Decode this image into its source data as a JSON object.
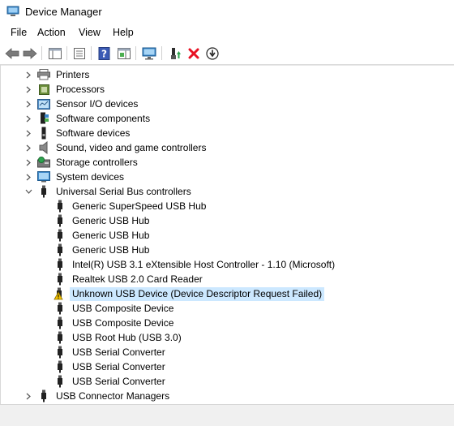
{
  "window": {
    "title": "Device Manager"
  },
  "menu": {
    "file": "File",
    "action": "Action",
    "view": "View",
    "help": "Help"
  },
  "tree": {
    "categories_top": [
      {
        "label": "Printers",
        "icon": "printer-icon"
      },
      {
        "label": "Processors",
        "icon": "processor-icon"
      },
      {
        "label": "Sensor I/O devices",
        "icon": "sensor-icon"
      },
      {
        "label": "Software components",
        "icon": "software-component-icon"
      },
      {
        "label": "Software devices",
        "icon": "software-device-icon"
      },
      {
        "label": "Sound, video and game controllers",
        "icon": "speaker-icon"
      },
      {
        "label": "Storage controllers",
        "icon": "storage-controller-icon"
      },
      {
        "label": "System devices",
        "icon": "system-device-icon"
      }
    ],
    "usb_controllers": {
      "label": "Universal Serial Bus controllers",
      "children": [
        {
          "label": "Generic SuperSpeed USB Hub"
        },
        {
          "label": "Generic USB Hub"
        },
        {
          "label": "Generic USB Hub"
        },
        {
          "label": "Generic USB Hub"
        },
        {
          "label": "Intel(R) USB 3.1 eXtensible Host Controller - 1.10 (Microsoft)"
        },
        {
          "label": "Realtek USB 2.0 Card Reader"
        },
        {
          "label": "Unknown USB Device (Device Descriptor Request Failed)",
          "warning": true,
          "selected": true
        },
        {
          "label": "USB Composite Device"
        },
        {
          "label": "USB Composite Device"
        },
        {
          "label": "USB Root Hub (USB 3.0)"
        },
        {
          "label": "USB Serial Converter"
        },
        {
          "label": "USB Serial Converter"
        },
        {
          "label": "USB Serial Converter"
        }
      ]
    },
    "usb_connector_managers": {
      "label": "USB Connector Managers"
    }
  },
  "colors": {
    "selection": "#cce8ff",
    "warning": "#f5c400",
    "delete": "#e81123",
    "help": "#3b5bb5"
  }
}
